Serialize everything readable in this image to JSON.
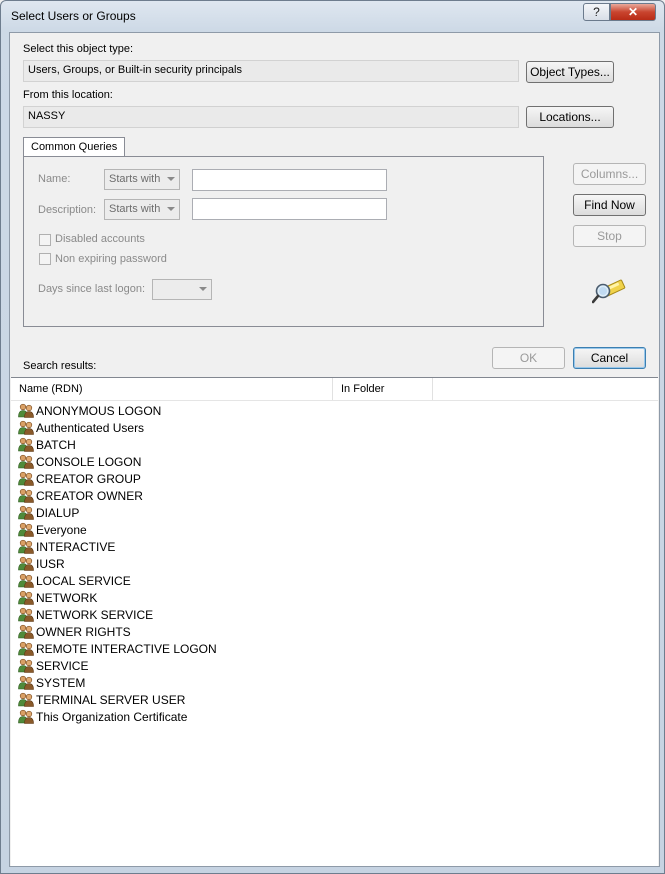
{
  "window": {
    "title": "Select Users or Groups",
    "help_label": "?",
    "close_label": "✕"
  },
  "object_type": {
    "label": "Select this object type:",
    "value": "Users, Groups, or Built-in security principals",
    "button": "Object Types..."
  },
  "location": {
    "label": "From this location:",
    "value": "NASSY",
    "button": "Locations..."
  },
  "queries": {
    "tab_label": "Common Queries",
    "name_label": "Name:",
    "name_mode": "Starts with",
    "name_value": "",
    "description_label": "Description:",
    "description_mode": "Starts with",
    "description_value": "",
    "disabled_accounts": "Disabled accounts",
    "non_expiring_password": "Non expiring password",
    "days_label": "Days since last logon:",
    "days_value": ""
  },
  "side_buttons": {
    "columns": "Columns...",
    "find_now": "Find Now",
    "stop": "Stop"
  },
  "dialog_buttons": {
    "ok": "OK",
    "cancel": "Cancel"
  },
  "results": {
    "label": "Search results:",
    "columns": [
      "Name (RDN)",
      "In Folder"
    ],
    "rows": [
      "ANONYMOUS LOGON",
      "Authenticated Users",
      "BATCH",
      "CONSOLE LOGON",
      "CREATOR GROUP",
      "CREATOR OWNER",
      "DIALUP",
      "Everyone",
      "INTERACTIVE",
      "IUSR",
      "LOCAL SERVICE",
      "NETWORK",
      "NETWORK SERVICE",
      "OWNER RIGHTS",
      "REMOTE INTERACTIVE LOGON",
      "SERVICE",
      "SYSTEM",
      "TERMINAL SERVER USER",
      "This Organization Certificate"
    ]
  },
  "icons": {
    "group": "group-icon",
    "search": "search-icon"
  }
}
